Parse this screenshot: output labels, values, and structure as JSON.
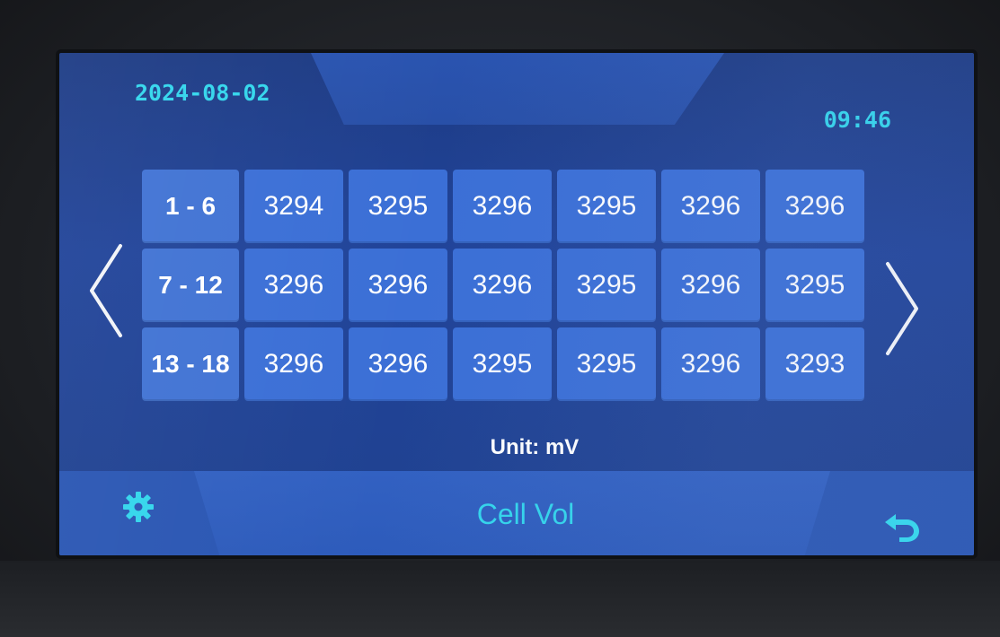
{
  "header": {
    "date": "2024-08-02",
    "time": "09:46"
  },
  "rows": [
    {
      "label": "1 - 6",
      "values": [
        "3294",
        "3295",
        "3296",
        "3295",
        "3296",
        "3296"
      ]
    },
    {
      "label": "7 - 12",
      "values": [
        "3296",
        "3296",
        "3296",
        "3295",
        "3296",
        "3295"
      ]
    },
    {
      "label": "13 - 18",
      "values": [
        "3296",
        "3296",
        "3295",
        "3295",
        "3296",
        "3293"
      ]
    }
  ],
  "unit_label": "Unit: mV",
  "footer": {
    "title": "Cell Vol",
    "settings_icon": "gear-icon",
    "back_icon": "back-arrow-icon"
  },
  "nav": {
    "prev_icon": "chevron-left-icon",
    "next_icon": "chevron-right-icon"
  },
  "colors": {
    "accent": "#33d6ec",
    "cell": "#3b6fd6",
    "background": "#21449a"
  }
}
